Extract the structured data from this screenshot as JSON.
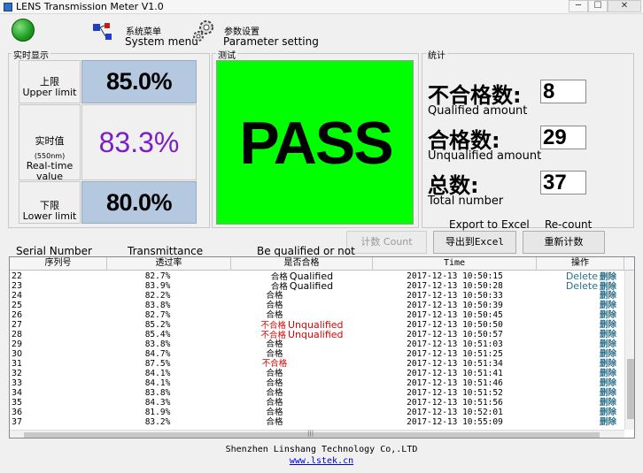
{
  "window": {
    "title": "LENS Transmission Meter V1.0",
    "minimize": "─",
    "maximize": "☐",
    "close": "✕"
  },
  "toolbar": {
    "system_menu_cn": "系统菜单",
    "system_menu_en": "System menu",
    "param_cn": "参数设置",
    "param_en": "Parameter setting"
  },
  "realtime": {
    "group_label": "实时显示",
    "upper_cn": "上限",
    "upper_en": "Upper limit",
    "upper_value": "85.0%",
    "real_cn": "实时值",
    "real_wave": "(550nm)",
    "real_en": "Real-time value",
    "real_value": "83.3%",
    "lower_cn": "下限",
    "lower_en": "Lower limit",
    "lower_value": "80.0%",
    "real_color": "#7b1fc4"
  },
  "test": {
    "group_label": "测试",
    "result": "PASS",
    "bg_color": "#00ff00"
  },
  "stats": {
    "group_label": "统计",
    "unq_cn": "不合格数:",
    "unq_en": "Qualified amount",
    "unq_value": "8",
    "q_cn": "合格数:",
    "q_en": "Unqualified amount",
    "q_value": "29",
    "total_cn": "总数:",
    "total_en": "Total number",
    "total_value": "37"
  },
  "buttons": {
    "count_label": "计数 Count",
    "export_caption": "Export to Excel",
    "export_label": "导出到Excel",
    "recount_caption": "Re-count",
    "recount_label": "重新计数"
  },
  "table": {
    "captions": {
      "sn": "Serial Number",
      "tr": "Transmittance",
      "ok": "Be qualified or not"
    },
    "headers": {
      "sn": "序列号",
      "tr": "透过率",
      "ok": "是否合格",
      "tm": "Time",
      "op": "操作"
    },
    "rows": [
      {
        "sn": "22",
        "tr": "82.7%",
        "ok": "合格",
        "ok_en": "Qualified",
        "bad": false,
        "tm": "2017-12-13 10:50:15",
        "op": "删除",
        "op_en": "Delete"
      },
      {
        "sn": "23",
        "tr": "83.9%",
        "ok": "合格",
        "ok_en": "Qualified",
        "bad": false,
        "tm": "2017-12-13 10:50:28",
        "op": "删除",
        "op_en": "Delete"
      },
      {
        "sn": "24",
        "tr": "82.2%",
        "ok": "合格",
        "ok_en": "",
        "bad": false,
        "tm": "2017-12-13 10:50:33",
        "op": "删除",
        "op_en": ""
      },
      {
        "sn": "25",
        "tr": "83.8%",
        "ok": "合格",
        "ok_en": "",
        "bad": false,
        "tm": "2017-12-13 10:50:39",
        "op": "删除",
        "op_en": ""
      },
      {
        "sn": "26",
        "tr": "82.7%",
        "ok": "合格",
        "ok_en": "",
        "bad": false,
        "tm": "2017-12-13 10:50:45",
        "op": "删除",
        "op_en": ""
      },
      {
        "sn": "27",
        "tr": "85.2%",
        "ok": "不合格",
        "ok_en": "Unqualified",
        "bad": true,
        "tm": "2017-12-13 10:50:50",
        "op": "删除",
        "op_en": ""
      },
      {
        "sn": "28",
        "tr": "85.4%",
        "ok": "不合格",
        "ok_en": "Unqualified",
        "bad": true,
        "tm": "2017-12-13 10:50:57",
        "op": "删除",
        "op_en": ""
      },
      {
        "sn": "29",
        "tr": "83.8%",
        "ok": "合格",
        "ok_en": "",
        "bad": false,
        "tm": "2017-12-13 10:51:03",
        "op": "删除",
        "op_en": ""
      },
      {
        "sn": "30",
        "tr": "84.7%",
        "ok": "合格",
        "ok_en": "",
        "bad": false,
        "tm": "2017-12-13 10:51:25",
        "op": "删除",
        "op_en": ""
      },
      {
        "sn": "31",
        "tr": "87.5%",
        "ok": "不合格",
        "ok_en": "",
        "bad": true,
        "tm": "2017-12-13 10:51:34",
        "op": "删除",
        "op_en": ""
      },
      {
        "sn": "32",
        "tr": "84.1%",
        "ok": "合格",
        "ok_en": "",
        "bad": false,
        "tm": "2017-12-13 10:51:41",
        "op": "删除",
        "op_en": ""
      },
      {
        "sn": "33",
        "tr": "84.1%",
        "ok": "合格",
        "ok_en": "",
        "bad": false,
        "tm": "2017-12-13 10:51:46",
        "op": "删除",
        "op_en": ""
      },
      {
        "sn": "34",
        "tr": "83.8%",
        "ok": "合格",
        "ok_en": "",
        "bad": false,
        "tm": "2017-12-13 10:51:52",
        "op": "删除",
        "op_en": ""
      },
      {
        "sn": "35",
        "tr": "84.3%",
        "ok": "合格",
        "ok_en": "",
        "bad": false,
        "tm": "2017-12-13 10:51:56",
        "op": "删除",
        "op_en": ""
      },
      {
        "sn": "36",
        "tr": "81.9%",
        "ok": "合格",
        "ok_en": "",
        "bad": false,
        "tm": "2017-12-13 10:52:01",
        "op": "删除",
        "op_en": ""
      },
      {
        "sn": "37",
        "tr": "83.2%",
        "ok": "合格",
        "ok_en": "",
        "bad": false,
        "tm": "2017-12-13 10:55:09",
        "op": "删除",
        "op_en": ""
      }
    ],
    "hscroll_grip": "|||"
  },
  "footer": {
    "company": "Shenzhen Linshang Technology Co,.LTD",
    "url": "www.lstek.cn"
  }
}
